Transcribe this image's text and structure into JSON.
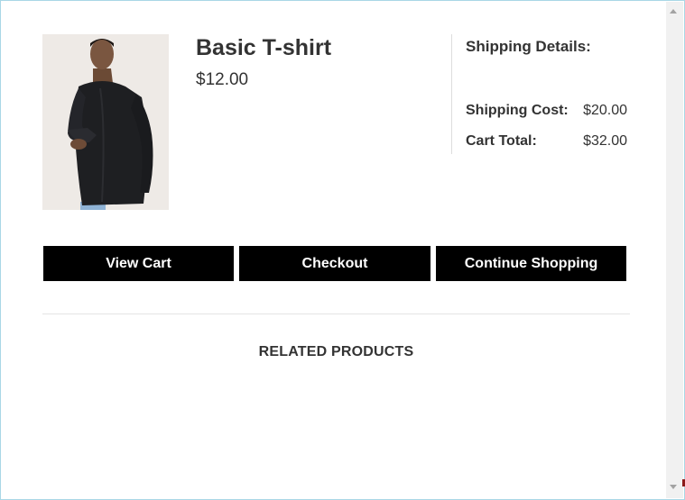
{
  "product": {
    "name": "Basic T-shirt",
    "price": "$12.00"
  },
  "shipping": {
    "title": "Shipping Details:",
    "cost_label": "Shipping Cost:",
    "cost_value": "$20.00",
    "total_label": "Cart Total:",
    "total_value": "$32.00"
  },
  "actions": {
    "view_cart": "View Cart",
    "checkout": "Checkout",
    "continue_shopping": "Continue Shopping"
  },
  "related": {
    "title": "RELATED PRODUCTS"
  },
  "colors": {
    "button_bg": "#000000",
    "button_text": "#ffffff",
    "text": "#333333"
  }
}
